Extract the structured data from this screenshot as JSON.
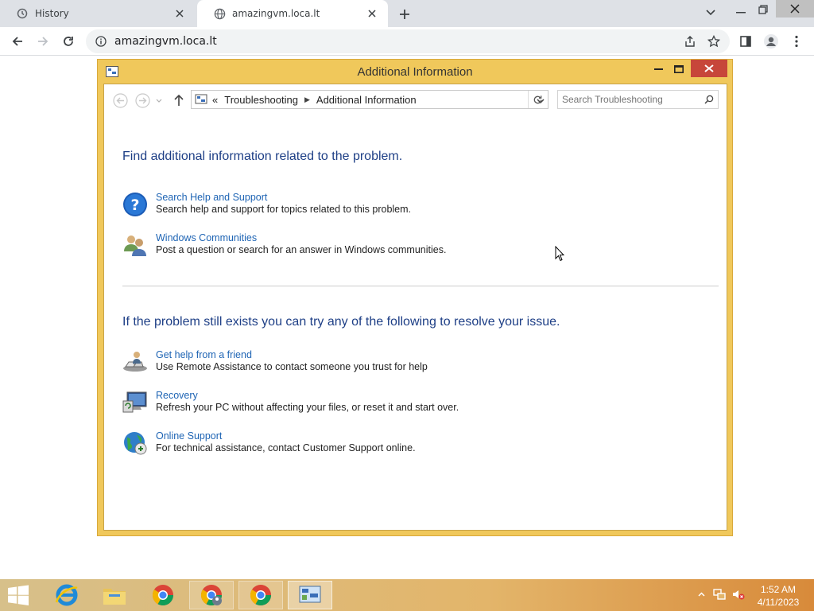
{
  "browser": {
    "tabs": [
      {
        "label": "History",
        "icon": "history-icon",
        "active": false
      },
      {
        "label": "amazingvm.loca.lt",
        "icon": "globe-icon",
        "active": true
      }
    ],
    "url": "amazingvm.loca.lt"
  },
  "window": {
    "title": "Additional Information",
    "breadcrumb": {
      "prefix": "«",
      "items": [
        "Troubleshooting",
        "Additional Information"
      ]
    },
    "search_placeholder": "Search Troubleshooting",
    "section1": {
      "heading": "Find additional information related to the problem.",
      "items": [
        {
          "link": "Search Help and Support",
          "desc": "Search help and support for topics related to this problem.",
          "icon": "help-icon"
        },
        {
          "link": "Windows Communities",
          "desc": "Post a question or search for an answer in Windows communities.",
          "icon": "users-icon"
        }
      ]
    },
    "section2": {
      "heading": "If the problem still exists you can try any of the following to resolve your issue.",
      "items": [
        {
          "link": "Get help from a friend",
          "desc": "Use Remote Assistance to contact someone you trust for help",
          "icon": "remote-assistance-icon"
        },
        {
          "link": "Recovery",
          "desc": "Refresh your PC without affecting your files, or reset it and start over.",
          "icon": "recovery-icon"
        },
        {
          "link": "Online Support",
          "desc": "For technical assistance, contact Customer Support online.",
          "icon": "globe-support-icon"
        }
      ]
    }
  },
  "taskbar": {
    "apps": [
      "internet-explorer-icon",
      "file-explorer-icon",
      "chrome-icon",
      "chrome-icon",
      "chrome-icon",
      "control-panel-icon"
    ],
    "time": "1:52 AM",
    "date": "4/11/2023"
  },
  "colors": {
    "window_frame": "#f0c85b",
    "heading": "#1e3f86",
    "link": "#1e64b4",
    "close": "#c7463a"
  }
}
